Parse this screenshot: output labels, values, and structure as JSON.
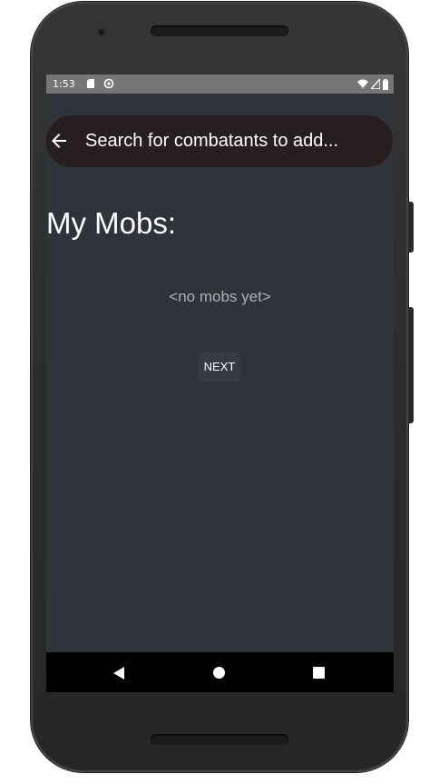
{
  "device": {
    "frame_color": "#2e2e2e"
  },
  "status_bar": {
    "time": "1:53",
    "icons": [
      "sd-card-icon",
      "sync-icon",
      "wifi-icon",
      "cell-signal-icon",
      "battery-icon"
    ]
  },
  "search": {
    "back_icon": "arrow-left-icon",
    "placeholder": "Search for combatants to add..."
  },
  "main": {
    "title": "My Mobs:",
    "empty_text": "<no mobs yet>",
    "next_label": "NEXT"
  },
  "nav_bar": {
    "icons": [
      "back-triangle-icon",
      "home-circle-icon",
      "recents-square-icon"
    ]
  },
  "colors": {
    "background": "#2e333c",
    "search_bar": "#261e1f",
    "status_bar": "#767676",
    "button": "#353a43"
  }
}
